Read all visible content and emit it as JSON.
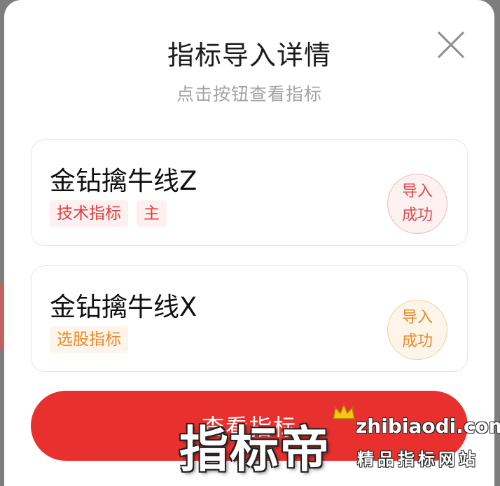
{
  "dialog": {
    "title": "指标导入详情",
    "subtitle": "点击按钮查看指标",
    "close_icon": "close-icon"
  },
  "indicators": [
    {
      "name": "金钻擒牛线Z",
      "tags": [
        "技术指标",
        "主"
      ],
      "tag_color": "#e03c3c",
      "status_line1": "导入",
      "status_line2": "成功",
      "status_color": "#e04a4a"
    },
    {
      "name": "金钻擒牛线X",
      "tags": [
        "选股指标"
      ],
      "tag_color": "#ec8a2a",
      "status_line1": "导入",
      "status_line2": "成功",
      "status_color": "#ec8a2a"
    }
  ],
  "view_button": {
    "label": "查看指标",
    "color": "#e8312f"
  },
  "watermark": {
    "brand": "指标帝",
    "url": "zhibiaodi.com",
    "slogan": "精品指标网站"
  }
}
